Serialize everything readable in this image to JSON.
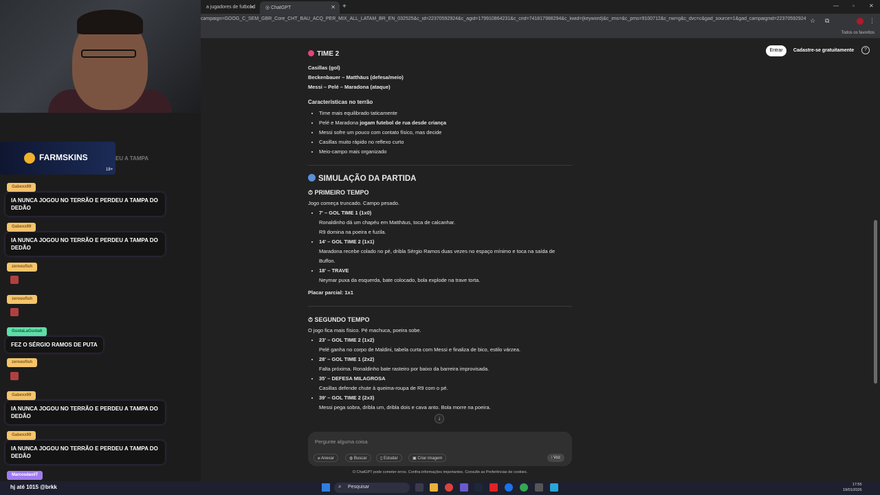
{
  "browser": {
    "tabs": [
      {
        "label": "a jugadores de futbol d"
      },
      {
        "label": "ChatGPT"
      }
    ],
    "new_tab": "+",
    "url": "campaign=GOOG_C_SEM_GBR_Core_CHT_BAU_ACQ_PER_MIX_ALL_LATAM_BR_EN_032525&c_id=22370592924&c_agid=179910864231&c_crid=741817988294&c_kwid={keyword}&c_ims=&c_pms=9100712&c_nw=g&c_dvc=c&gad_source=1&gad_campaignid=22370592924&gbr...",
    "bookmarks_label": "Todos os favoritos"
  },
  "chatgpt": {
    "login": "Entrar",
    "signup": "Cadastre-se gratuitamente",
    "help": "?",
    "time2": {
      "title": "TIME 2",
      "lines": [
        "Casillas (gol)",
        "Beckenbauer – Matthäus (defesa/meio)",
        "Messi – Pelé – Maradona (ataque)"
      ],
      "char_title": "Características no terrão",
      "bullets": [
        "Time mais equilibrado taticamente",
        "Pelé e Maradona ",
        "jogam futebol de rua desde criança",
        "Messi sofre um pouco com contato físico, mas decide",
        "Casillas muito rápido no reflexo curto",
        "Meio-campo mais organizado"
      ]
    },
    "simulation_title": "SIMULAÇÃO DA PARTIDA",
    "first_half": {
      "title": "PRIMEIRO TEMPO",
      "intro": "Jogo começa truncado. Campo pesado.",
      "events": [
        {
          "head": "7' – GOL TIME 1 (1x0)",
          "text": "Ronaldinho dá um chapéu em Matthäus, toca de calcanhar.",
          "text2": "R9 domina na poeira e fuzila."
        },
        {
          "head": "14' – GOL TIME 2 (1x1)",
          "text": "Maradona recebe colado no pé, dribla Sérgio Ramos duas vezes no espaço mínimo e toca na saída de Buffon."
        },
        {
          "head": "18' – TRAVE",
          "text": "Neymar puxa da esquerda, bate colocado, bola explode na trave torta."
        }
      ],
      "partial": "Placar parcial: 1x1"
    },
    "second_half": {
      "title": "SEGUNDO TEMPO",
      "intro": "O jogo fica mais físico. Pé machuca, poeira sobe.",
      "events": [
        {
          "head": "23' – GOL TIME 2 (1x2)",
          "text": "Pelé ganha no corpo de Maldini, tabela curta com Messi e finaliza de bico, estilo várzea."
        },
        {
          "head": "28' – GOL TIME 1 (2x2)",
          "text": "Falta próxima. Ronaldinho bate rasteiro por baixo da barreira improvisada."
        },
        {
          "head": "35' – DEFESA MILAGROSA",
          "text": "Casillas defende chute à queima-roupa de R9 com o pé."
        },
        {
          "head": "39' – GOL TIME 2 (2x3)",
          "text": "Messi pega sobra, dribla um, dribla dois e cava   anto. Bola morre na poeira."
        }
      ]
    },
    "composer": {
      "placeholder": "Pergunte alguma coisa",
      "buttons": [
        "Anexar",
        "Buscar",
        "Estudar",
        "Criar imagem"
      ],
      "voice": "Voz"
    },
    "disclaimer": "O ChatGPT pode cometer erros. Confira informações importantes. Consulte as Preferências de cookies."
  },
  "stream": {
    "sponsor": "FARMSKINS",
    "sponsor_badge": "18+",
    "ghost_text": "EU A TAMPA",
    "chat": [
      {
        "user": "Gabexx99",
        "text": "IA NUNCA JOGOU NO TERRÃO E PERDEU A TAMPA DO DEDÃO"
      },
      {
        "user": "Gabexx99",
        "text": "IA NUNCA JOGOU NO TERRÃO E PERDEU A TAMPA DO DEDÃO"
      },
      {
        "user": "zeroeufish",
        "text": ""
      },
      {
        "user": "zeroeufish",
        "text": ""
      },
      {
        "user": "GustaLaGusta6",
        "text": "FEZ O SÉRGIO RAMOS DE PUTA"
      },
      {
        "user": "zeroeufish",
        "text": ""
      },
      {
        "user": "Gabexx99",
        "text": "IA NUNCA JOGOU NO TERRÃO E PERDEU A TAMPA DO DEDÃO"
      },
      {
        "user": "Gabexx99",
        "text": "IA NUNCA JOGOU NO TERRÃO E PERDEU A TAMPA DO DEDÃO"
      },
      {
        "user": "MarcosdavilT",
        "text": ""
      }
    ],
    "bottom_msg": "hj até 1015 @brkk"
  },
  "taskbar": {
    "search": "Pesquisar",
    "time": "17:55",
    "date": "19/01/2026"
  },
  "colors": {
    "team2_dot": "#e0457b",
    "sim_dot": "#5b8fd6",
    "nick_bg": "#f6c46b",
    "nick_green": "#5ee0a8",
    "nick_purple": "#a07bf0"
  }
}
